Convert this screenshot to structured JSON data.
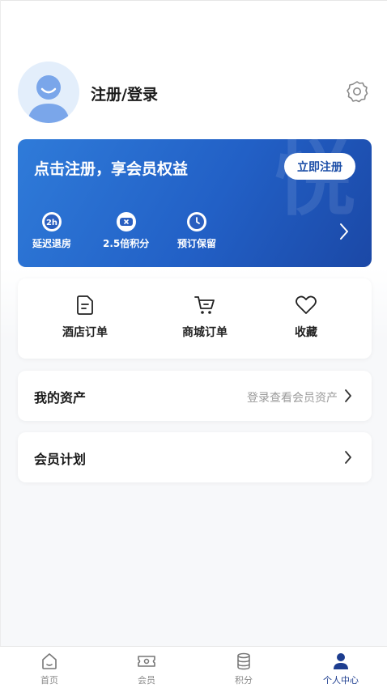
{
  "profile": {
    "login_label": "注册/登录",
    "avatar_icon": "user-avatar-icon",
    "settings_icon": "gear-icon"
  },
  "member_card": {
    "title": "点击注册，享会员权益",
    "register_button": "立即注册",
    "watermark": "悦",
    "benefits": [
      {
        "label": "延迟退房",
        "icon": "clock-2h-icon"
      },
      {
        "label": "2.5倍积分",
        "icon": "points-multiplier-icon"
      },
      {
        "label": "预订保留",
        "icon": "clock-icon"
      }
    ],
    "accent_color": "#2260c6"
  },
  "orders": [
    {
      "label": "酒店订单",
      "icon": "document-icon"
    },
    {
      "label": "商城订单",
      "icon": "cart-icon"
    },
    {
      "label": "收藏",
      "icon": "heart-icon"
    }
  ],
  "assets_row": {
    "title": "我的资产",
    "hint": "登录查看会员资产"
  },
  "plan_row": {
    "title": "会员计划"
  },
  "tabbar": {
    "tabs": [
      {
        "label": "首页",
        "icon": "home-icon",
        "active": false
      },
      {
        "label": "会员",
        "icon": "member-ticket-icon",
        "active": false
      },
      {
        "label": "积分",
        "icon": "coins-icon",
        "active": false
      },
      {
        "label": "个人中心",
        "icon": "person-icon",
        "active": true
      }
    ],
    "active_color": "#1d3d8f"
  }
}
